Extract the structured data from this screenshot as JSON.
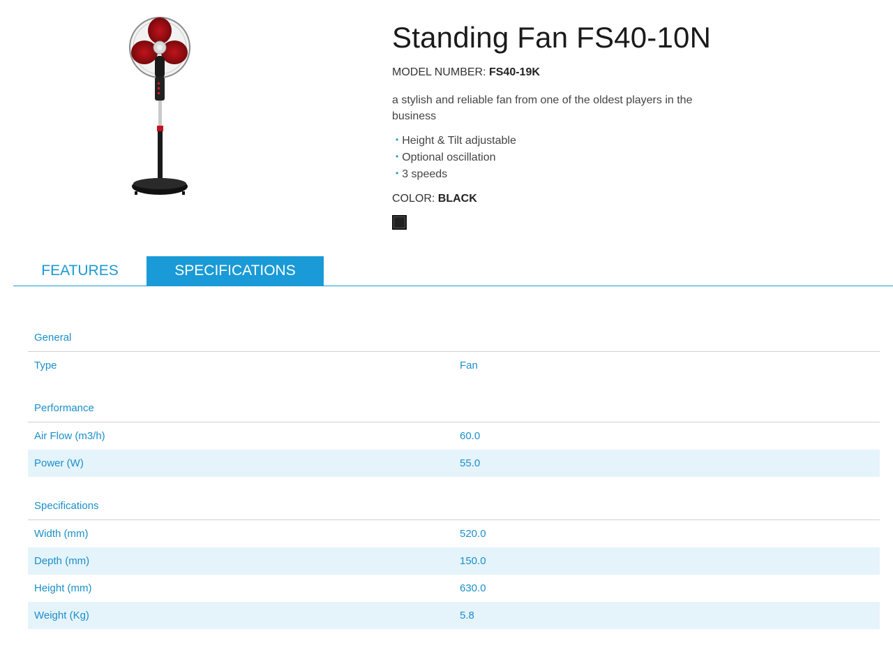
{
  "product": {
    "title": "Standing Fan FS40-10N",
    "model_label": "MODEL NUMBER: ",
    "model_value": "FS40-19K",
    "description": "a stylish and reliable fan from one of the oldest players in the business",
    "features": [
      "Height & Tilt adjustable",
      "Optional oscillation",
      "3 speeds"
    ],
    "color_label": "COLOR: ",
    "color_value": "BLACK",
    "swatch_color": "#222222",
    "image_icon": "standing-fan-icon"
  },
  "tabs": {
    "features": "FEATURES",
    "specifications": "SPECIFICATIONS",
    "active": "specifications"
  },
  "specs": {
    "general": {
      "title": "General",
      "rows": [
        {
          "label": "Type",
          "value": "Fan"
        }
      ]
    },
    "performance": {
      "title": "Performance",
      "rows": [
        {
          "label": "Air Flow (m3/h)",
          "value": "60.0"
        },
        {
          "label": "Power (W)",
          "value": "55.0"
        }
      ]
    },
    "specifications": {
      "title": "Specifications",
      "rows": [
        {
          "label": "Width (mm)",
          "value": "520.0"
        },
        {
          "label": "Depth (mm)",
          "value": "150.0"
        },
        {
          "label": "Height (mm)",
          "value": "630.0"
        },
        {
          "label": "Weight (Kg)",
          "value": "5.8"
        }
      ]
    }
  },
  "colors": {
    "accent": "#1a9ad6",
    "row_alt": "#e5f3fb"
  }
}
